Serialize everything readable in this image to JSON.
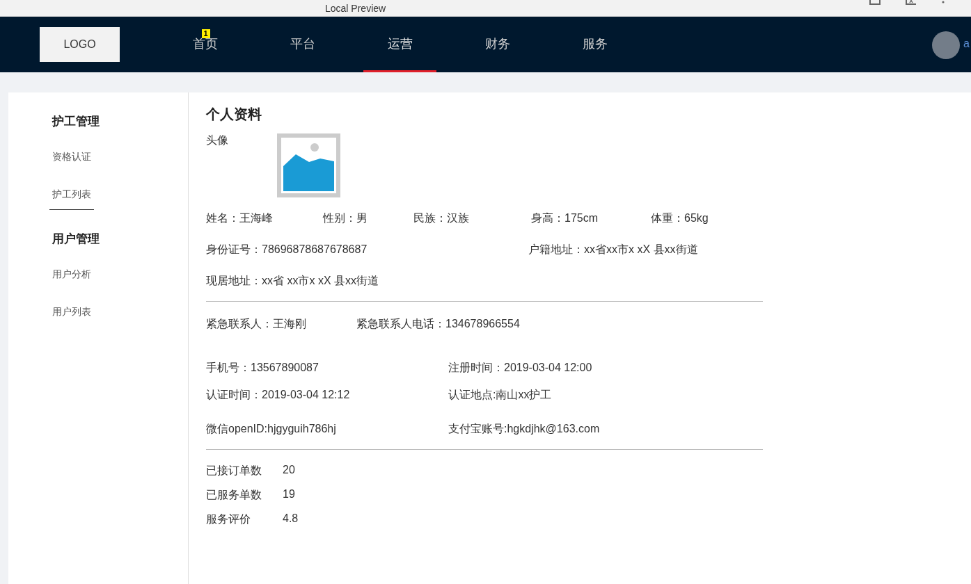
{
  "browser": {
    "title": "Local Preview"
  },
  "nav": {
    "logo": "LOGO",
    "items": [
      {
        "label": "首页",
        "selected": false,
        "badge": "1"
      },
      {
        "label": "平台",
        "selected": false
      },
      {
        "label": "运营",
        "selected": true
      },
      {
        "label": "财务",
        "selected": false
      },
      {
        "label": "服务",
        "selected": false
      }
    ],
    "user": "a"
  },
  "sidebar": {
    "groups": [
      {
        "title": "护工管理",
        "items": [
          {
            "label": "资格认证",
            "selected": false
          },
          {
            "label": "护工列表",
            "selected": true
          }
        ]
      },
      {
        "title": "用户管理",
        "items": [
          {
            "label": "用户分析",
            "selected": false
          },
          {
            "label": "用户列表",
            "selected": false
          }
        ]
      }
    ]
  },
  "profile": {
    "title": "个人资料",
    "avatar_label": "头像",
    "lines": [
      {
        "fields": [
          "姓名：王海峰",
          "性别：男",
          "民族：汉族",
          "身高：175cm",
          "体重：65kg"
        ]
      },
      {
        "fields": [
          "身份证号：78696878687678687",
          "户籍地址：xx省xx市x xX 县xx街道"
        ]
      },
      {
        "fields": [
          "现居地址：xx省 xx市x xX 县xx街道"
        ]
      }
    ],
    "contact": [
      "紧急联系人：王海刚",
      "紧急联系人电话：134678966554"
    ],
    "details": [
      {
        "fields": [
          "手机号：13567890087",
          "注册时间：2019-03-04 12:00"
        ]
      },
      {
        "fields": [
          "认证时间：2019-03-04 12:12",
          "认证地点:南山xx护工"
        ]
      },
      {
        "fields": [
          "微信openID:hjgyguih786hj",
          "支付宝账号:hgkdjhk@163.com"
        ]
      }
    ],
    "stats": [
      {
        "label": "已接订单数",
        "value": "20"
      },
      {
        "label": "已服务单数",
        "value": "19"
      },
      {
        "label": "服务评价",
        "value": "4.8"
      }
    ]
  }
}
